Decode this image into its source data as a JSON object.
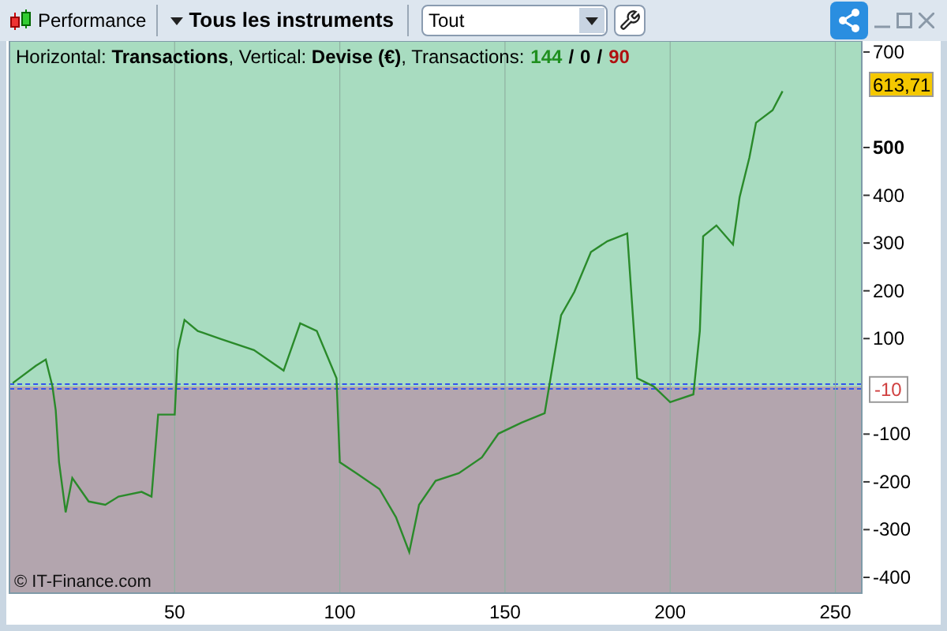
{
  "toolbar": {
    "view_button": "Performance",
    "instruments_menu": "Tous les instruments",
    "filter_select": {
      "value": "Tout"
    }
  },
  "chart": {
    "info": {
      "text": "Horizontal: **Transactions**, Vertical: **Devise (€)**, Transactions: ",
      "counts": [
        {
          "value": "144",
          "color": "#1f8f1f"
        },
        {
          "value": "0",
          "color": "#000000"
        },
        {
          "value": "90",
          "color": "#b01010"
        }
      ],
      "separators": [
        "/",
        "/"
      ]
    },
    "last_value_badge": "613,71",
    "zero_badge": "-10",
    "copyright": "© IT-Finance.com",
    "chart_data": {
      "type": "line",
      "grid": true,
      "xlim": [
        0,
        258
      ],
      "ylim": [
        -433,
        723
      ],
      "xticks": [
        50,
        100,
        150,
        200,
        250
      ],
      "yticks": [
        -400,
        -300,
        -200,
        -100,
        100,
        200,
        300,
        400,
        500,
        700
      ],
      "x": [
        1,
        8,
        11,
        13,
        14,
        15,
        17,
        19,
        24,
        29,
        33,
        40,
        43,
        45,
        50,
        51,
        53,
        57,
        64,
        74,
        83,
        88,
        93,
        99,
        100,
        105,
        112,
        117,
        121,
        124,
        129,
        136,
        143,
        148,
        155,
        162,
        167,
        171,
        176,
        181,
        187,
        190,
        195,
        200,
        207,
        209,
        210,
        214,
        219,
        221,
        224,
        226,
        231,
        234
      ],
      "series": [
        {
          "color": "#2a8a2a",
          "values": [
            7,
            43,
            56,
            0,
            -50,
            -159,
            -264,
            -192,
            -241,
            -248,
            -231,
            -221,
            -231,
            -59,
            -59,
            76,
            139,
            116,
            99,
            76,
            33,
            132,
            116,
            17,
            -159,
            -182,
            -215,
            -274,
            -347,
            -248,
            -198,
            -182,
            -149,
            -99,
            -76,
            -56,
            149,
            198,
            281,
            304,
            320,
            17,
            0,
            -33,
            -17,
            116,
            314,
            337,
            297,
            396,
            479,
            552,
            578,
            618
          ]
        }
      ]
    }
  }
}
